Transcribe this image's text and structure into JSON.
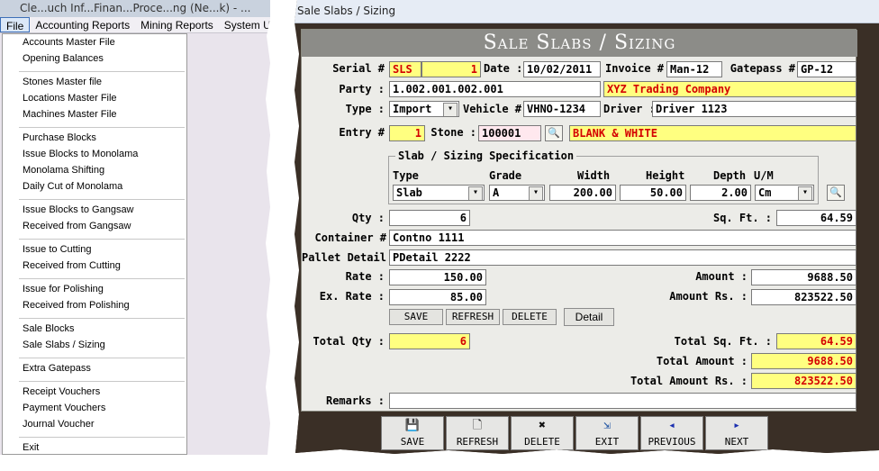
{
  "menu_window": {
    "title_text": "Cle...uch Inf...Finan...Proce...ng (Ne...k) - ...",
    "menubar": [
      "File",
      "Accounting Reports",
      "Mining Reports",
      "System Utilities"
    ],
    "file_menu_groups": [
      [
        "Accounts Master File",
        "Opening Balances"
      ],
      [
        "Stones Master file",
        "Locations Master File",
        "Machines Master File"
      ],
      [
        "Purchase Blocks",
        "Issue Blocks to Monolama",
        "Monolama Shifting",
        "Daily Cut of Monolama"
      ],
      [
        "Issue Blocks to Gangsaw",
        "Received from Gangsaw"
      ],
      [
        "Issue to Cutting",
        "Received from Cutting"
      ],
      [
        "Issue for Polishing",
        "Received from Polishing"
      ],
      [
        "Sale Blocks",
        "Sale Slabs / Sizing"
      ],
      [
        "Extra Gatepass"
      ],
      [
        "Receipt Vouchers",
        "Payment Vouchers",
        "Journal Voucher"
      ],
      [
        "Exit"
      ]
    ]
  },
  "form": {
    "window_title": "Sale Slabs / Sizing",
    "header": "Sale Slabs / Sizing",
    "labels": {
      "serial": "Serial #",
      "date": "Date :",
      "invoice": "Invoice #",
      "gatepass": "Gatepass #",
      "party": "Party :",
      "type": "Type :",
      "vehicle": "Vehicle #",
      "driver": "Driver :",
      "entry": "Entry #",
      "stone": "Stone :",
      "spec_title": "Slab / Sizing Specification",
      "col_type": "Type",
      "col_grade": "Grade",
      "col_width": "Width",
      "col_height": "Height",
      "col_depth": "Depth",
      "col_um": "U/M",
      "qty": "Qty :",
      "sqft": "Sq. Ft. :",
      "container": "Container #",
      "pallet": "Pallet Detail :",
      "rate": "Rate :",
      "amount": "Amount :",
      "ex_rate": "Ex. Rate :",
      "amount_rs": "Amount Rs. :",
      "total_qty": "Total Qty :",
      "total_sqft": "Total Sq. Ft. :",
      "total_amount": "Total Amount :",
      "total_amount_rs": "Total Amount Rs. :",
      "remarks": "Remarks :"
    },
    "values": {
      "serial_prefix": "SLS",
      "serial_no": "1",
      "date": "10/02/2011",
      "invoice": "Man-12",
      "gatepass": "GP-12",
      "party_code": "1.002.001.002.001",
      "party_name": "XYZ Trading Company",
      "type": "Import",
      "vehicle": "VHNO-1234",
      "driver": "Driver 1123",
      "entry": "1",
      "stone_code": "100001",
      "stone_name": "BLANK & WHITE",
      "slab_type": "Slab",
      "grade": "A",
      "width": "200.00",
      "height": "50.00",
      "depth": "2.00",
      "um": "Cm",
      "qty": "6",
      "sqft": "64.59",
      "container": "Contno 1111",
      "pallet": "PDetail 2222",
      "rate": "150.00",
      "amount": "9688.50",
      "ex_rate": "85.00",
      "amount_rs": "823522.50",
      "total_qty": "6",
      "total_sqft": "64.59",
      "total_amount": "9688.50",
      "total_amount_rs": "823522.50",
      "remarks": ""
    },
    "detail_buttons": [
      "SAVE",
      "REFRESH",
      "DELETE",
      "Detail"
    ],
    "nav_buttons": [
      {
        "label": "SAVE",
        "icon": "save-icon"
      },
      {
        "label": "REFRESH",
        "icon": "document-icon"
      },
      {
        "label": "DELETE",
        "icon": "delete-icon"
      },
      {
        "label": "EXIT",
        "icon": "exit-icon"
      },
      {
        "label": "PREVIOUS",
        "icon": "arrow-left-icon"
      },
      {
        "label": "NEXT",
        "icon": "arrow-right-icon"
      }
    ]
  }
}
